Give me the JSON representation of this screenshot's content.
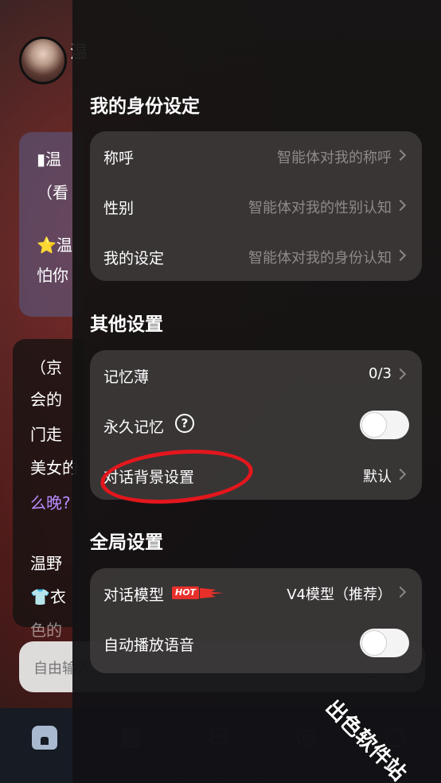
{
  "background": {
    "chat_name_fragment": "温",
    "card1": [
      "▮温",
      "（看",
      "⭐温",
      "怕你"
    ],
    "card2": [
      "（京",
      "会的",
      "门走",
      "美女的",
      "么晚?",
      "温野",
      "👕衣",
      "色的"
    ],
    "input_placeholder": "自由输入",
    "tabs": [
      "home-icon",
      "discover-icon",
      "create-ai-icon",
      "messages-icon",
      "profile-icon"
    ]
  },
  "identity": {
    "title": "我的身份设定",
    "rows": [
      {
        "label": "称呼",
        "value": "智能体对我的称呼"
      },
      {
        "label": "性别",
        "value": "智能体对我的性别认知"
      },
      {
        "label": "我的设定",
        "value": "智能体对我的身份认知"
      }
    ]
  },
  "other": {
    "title": "其他设置",
    "memo": {
      "label": "记忆薄",
      "value": "0/3"
    },
    "perm_memory": {
      "label": "永久记忆",
      "help": "?",
      "enabled": false
    },
    "bg_setting": {
      "label": "对话背景设置",
      "value": "默认"
    }
  },
  "global": {
    "title": "全局设置",
    "model": {
      "label": "对话模型",
      "badge": "HOT",
      "value": "V4模型（推荐）"
    },
    "autoplay": {
      "label": "自动播放语音",
      "enabled": false
    }
  },
  "watermark": "出色软件站",
  "colors": {
    "hot_badge": "#e8302a",
    "highlight_ellipse": "#e4161c"
  }
}
